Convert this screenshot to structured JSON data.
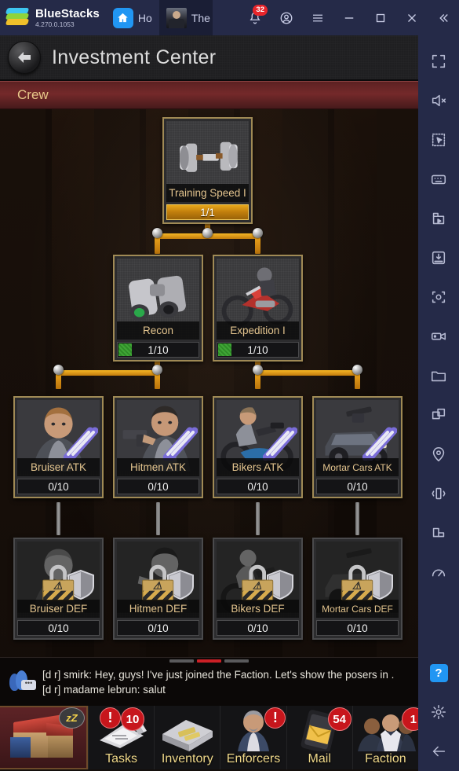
{
  "bluestacks": {
    "brand": "BlueStacks",
    "version": "4.270.0.1053",
    "tabs": [
      {
        "label": "Ho",
        "icon": "home-icon",
        "active": false
      },
      {
        "label": "The",
        "icon": "game-thumbnail",
        "active": true
      }
    ],
    "notification_count": "32",
    "controls": {
      "account": "account-icon",
      "menu": "hamburger-menu-icon",
      "minimize": "minimize-icon",
      "maximize": "maximize-icon",
      "close": "close-icon",
      "collapse": "collapse-icon"
    }
  },
  "rail": {
    "items": [
      {
        "name": "fullscreen-icon"
      },
      {
        "name": "mute-icon"
      },
      {
        "name": "multi-select-icon"
      },
      {
        "name": "keyboard-controls-icon"
      },
      {
        "name": "macro-recorder-icon"
      },
      {
        "name": "install-apk-icon"
      },
      {
        "name": "screenshot-icon"
      },
      {
        "name": "screen-record-icon"
      },
      {
        "name": "media-folder-icon"
      },
      {
        "name": "multi-instance-icon"
      },
      {
        "name": "location-icon"
      },
      {
        "name": "shake-icon"
      },
      {
        "name": "rotate-icon"
      },
      {
        "name": "performance-icon"
      }
    ],
    "help_label": "?",
    "settings": "gear-icon",
    "back": "back-arrow-icon"
  },
  "game": {
    "header": {
      "title": "Investment Center",
      "back": "back-arrow-icon"
    },
    "section": {
      "label": "Crew"
    },
    "tree": {
      "rows": [
        {
          "row": 1,
          "nodes": [
            {
              "name": "Training Speed I",
              "progress": "1/1",
              "state": "maxed",
              "icon": "dumbbell-icon",
              "badge": "none"
            }
          ]
        },
        {
          "row": 2,
          "nodes": [
            {
              "name": "Recon",
              "progress": "1/10",
              "state": "partial",
              "icon": "binoculars-icon",
              "badge": "none"
            },
            {
              "name": "Expedition I",
              "progress": "1/10",
              "state": "partial",
              "icon": "motorcycle-rider-icon",
              "badge": "none"
            }
          ]
        },
        {
          "row": 3,
          "nodes": [
            {
              "name": "Bruiser ATK",
              "progress": "0/10",
              "state": "unlocked",
              "icon": "bruiser-portrait",
              "badge": "atk-swords-icon"
            },
            {
              "name": "Hitmen ATK",
              "progress": "0/10",
              "state": "unlocked",
              "icon": "hitman-portrait",
              "badge": "atk-swords-icon"
            },
            {
              "name": "Bikers ATK",
              "progress": "0/10",
              "state": "unlocked",
              "icon": "biker-portrait",
              "badge": "atk-swords-icon"
            },
            {
              "name": "Mortar Cars ATK",
              "progress": "0/10",
              "state": "unlocked",
              "icon": "mortar-car-icon",
              "badge": "atk-swords-icon"
            }
          ]
        },
        {
          "row": 4,
          "nodes": [
            {
              "name": "Bruiser DEF",
              "progress": "0/10",
              "state": "locked",
              "icon": "bruiser-portrait",
              "badge": "def-shield-icon"
            },
            {
              "name": "Hitmen DEF",
              "progress": "0/10",
              "state": "locked",
              "icon": "hitman-portrait",
              "badge": "def-shield-icon"
            },
            {
              "name": "Bikers DEF",
              "progress": "0/10",
              "state": "locked",
              "icon": "biker-portrait",
              "badge": "def-shield-icon"
            },
            {
              "name": "Mortar Cars DEF",
              "progress": "0/10",
              "state": "locked",
              "icon": "mortar-car-icon",
              "badge": "def-shield-icon"
            }
          ]
        }
      ]
    },
    "chat": {
      "line1": "[d r] smirk: Hey, guys! I've just joined the Faction. Let's show the posers in .",
      "line2": "[d r] madame lebrun: salut",
      "icon": "chat-group-icon"
    },
    "nav": {
      "home": {
        "name": "home-base-button",
        "status": "zZ"
      },
      "items": [
        {
          "label": "Tasks",
          "badge": "10",
          "badge2": "!",
          "icon": "tasks-icon"
        },
        {
          "label": "Inventory",
          "badge": "",
          "badge2": "",
          "icon": "inventory-icon"
        },
        {
          "label": "Enforcers",
          "badge": "",
          "badge2": "!",
          "icon": "enforcers-icon"
        },
        {
          "label": "Mail",
          "badge": "54",
          "badge2": "",
          "icon": "mail-icon"
        },
        {
          "label": "Faction",
          "badge": "1",
          "badge2": "",
          "icon": "faction-icon"
        }
      ]
    }
  },
  "colors": {
    "accent_gold": "#e8a81c",
    "crew_red": "#74292a",
    "badge_red": "#c7161c",
    "rail_bg": "#252a48",
    "label_gold": "#e3c48e"
  }
}
